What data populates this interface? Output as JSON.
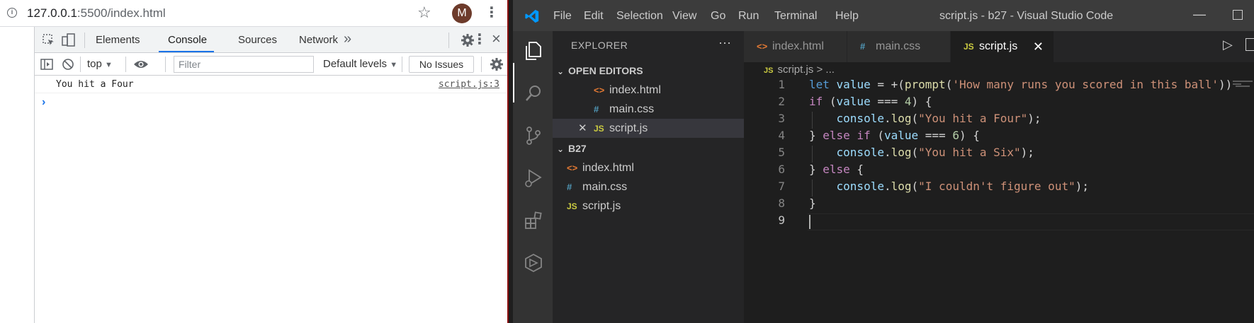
{
  "browser": {
    "url_host": "127.0.0.1",
    "url_path": ":5500/index.html",
    "avatar_letter": "M"
  },
  "devtools": {
    "tabs": [
      "Elements",
      "Console",
      "Sources",
      "Network"
    ],
    "active_tab": "Console",
    "more_tabs": "»",
    "context": "top",
    "filter_placeholder": "Filter",
    "levels": "Default levels",
    "issues": "No Issues",
    "console": [
      {
        "message": "You hit a Four",
        "source": "script.js:3"
      }
    ],
    "prompt_symbol": "›"
  },
  "vscode": {
    "menu": [
      "File",
      "Edit",
      "Selection",
      "View",
      "Go",
      "Run",
      "Terminal",
      "Help"
    ],
    "window_title": "script.js - b27 - Visual Studio Code",
    "explorer_title": "EXPLORER",
    "open_editors_label": "OPEN EDITORS",
    "folder_label": "B27",
    "open_editors": [
      {
        "name": "index.html",
        "type": "html"
      },
      {
        "name": "main.css",
        "type": "css"
      },
      {
        "name": "script.js",
        "type": "js",
        "active": true
      }
    ],
    "folder_files": [
      {
        "name": "index.html",
        "type": "html"
      },
      {
        "name": "main.css",
        "type": "css"
      },
      {
        "name": "script.js",
        "type": "js"
      }
    ],
    "tabs": [
      {
        "name": "index.html",
        "type": "html"
      },
      {
        "name": "main.css",
        "type": "css"
      },
      {
        "name": "script.js",
        "type": "js",
        "active": true
      }
    ],
    "breadcrumb": {
      "file": "script.js",
      "rest": "> ..."
    },
    "code_lines": [
      "let value = +(prompt('How many runs you scored in this ball'))",
      "if (value === 4) {",
      "    console.log(\"You hit a Four\");",
      "} else if (value === 6) {",
      "    console.log(\"You hit a Six\");",
      "} else {",
      "    console.log(\"I couldn't figure out\");",
      "}",
      ""
    ],
    "colors": {
      "accent_blue": "#569cd6",
      "string": "#ce9178",
      "number": "#b5cea8",
      "html_icon": "#e37933",
      "css_icon": "#519aba",
      "js_icon": "#cbcb41"
    }
  }
}
